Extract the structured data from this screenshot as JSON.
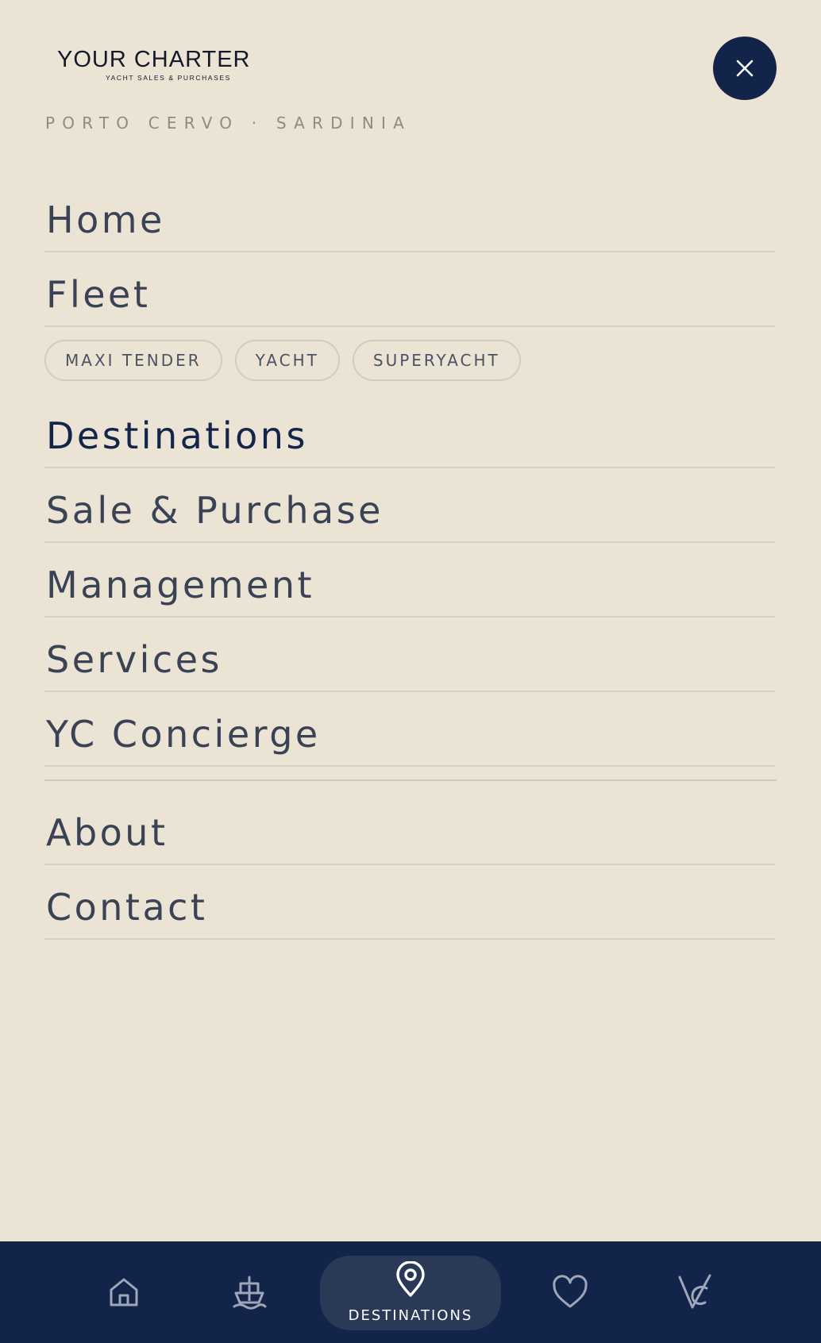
{
  "brand": {
    "name": "YOUR CHARTER",
    "tagline": "YACHT SALES & PURCHASES"
  },
  "location": "PORTO CERVO · SARDINIA",
  "nav": {
    "home": "Home",
    "fleet": "Fleet",
    "destinations": "Destinations",
    "sale_purchase": "Sale & Purchase",
    "management": "Management",
    "services": "Services",
    "concierge": "YC Concierge",
    "about": "About",
    "contact": "Contact"
  },
  "fleet_chips": [
    "MAXI TENDER",
    "YACHT",
    "SUPERYACHT"
  ],
  "tabbar": {
    "tabs": [
      {
        "icon": "home-icon"
      },
      {
        "icon": "boat-icon"
      },
      {
        "icon": "location-pin-icon",
        "label": "DESTINATIONS",
        "active": true
      },
      {
        "icon": "heart-icon"
      },
      {
        "icon": "yc-logo-icon"
      }
    ]
  },
  "colors": {
    "background": "#ebe4d4",
    "navy": "#13244a",
    "active_pill": "#293956",
    "text": "#3a4256"
  }
}
